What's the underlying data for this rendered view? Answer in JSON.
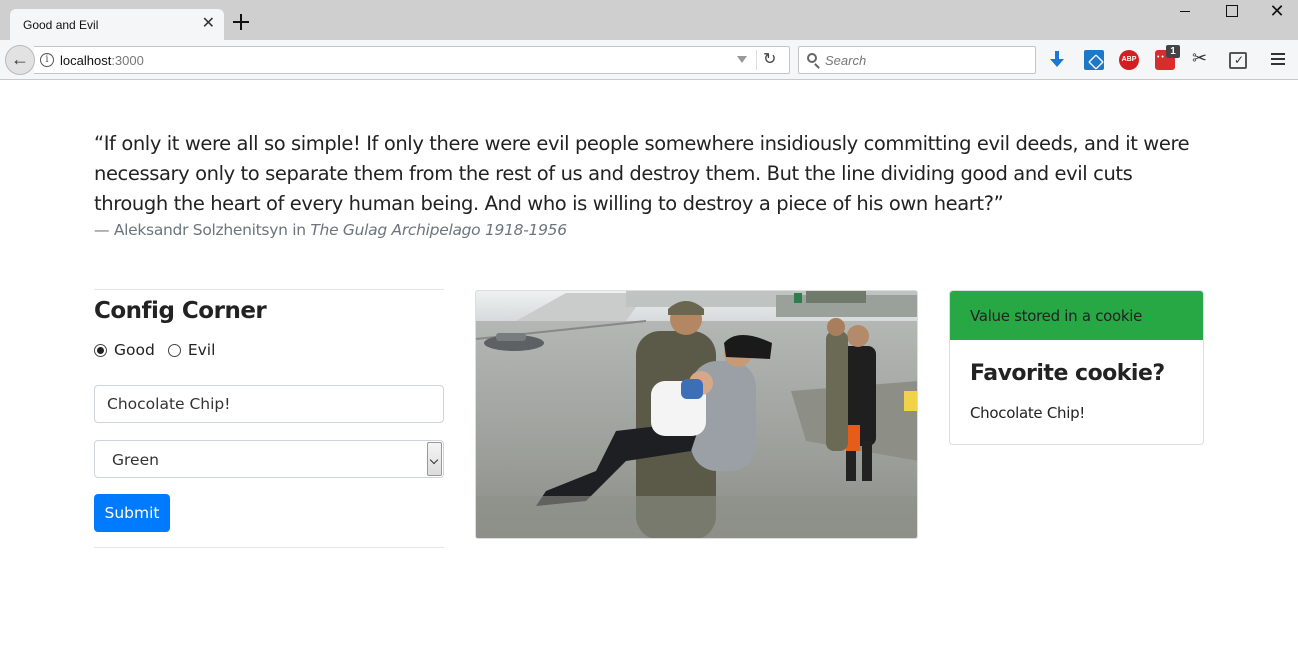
{
  "browser": {
    "tab_title": "Good and Evil",
    "url_host": "localhost",
    "url_port": ":3000",
    "search_placeholder": "Search",
    "extension_badge": "1",
    "abp_label": "ABP",
    "info_symbol": "i",
    "close_symbol": "✕",
    "back_symbol": "←",
    "reload_symbol": "↻"
  },
  "quote": {
    "text": "“If only it were all so simple! If only there were evil people somewhere insidiously committing evil deeds, and it were necessary only to separate them from the rest of us and destroy them. But the line dividing good and evil cuts through the heart of every human being. And who is willing to destroy a piece of his own heart?”",
    "attribution_prefix": "— Aleksandr Solzhenitsyn in ",
    "source": "The Gulag Archipelago 1918-1956"
  },
  "config": {
    "title": "Config Corner",
    "radio_options": [
      "Good",
      "Evil"
    ],
    "selected_radio": "Good",
    "cookie_value": "Chocolate Chip!",
    "color_selected": "Green",
    "submit_label": "Submit"
  },
  "card": {
    "header": "Value stored in a cookie",
    "title": "Favorite cookie?",
    "text": "Chocolate Chip!"
  },
  "colors": {
    "primary": "#007bff",
    "success": "#28a745",
    "muted": "#6c757d"
  },
  "icons": [
    "back-icon",
    "info-icon",
    "dropdown-icon",
    "reload-icon",
    "search-icon",
    "download-icon",
    "extension-icon",
    "adblock-icon",
    "todo-icon",
    "scissors-icon",
    "checklist-icon",
    "menu-icon"
  ]
}
